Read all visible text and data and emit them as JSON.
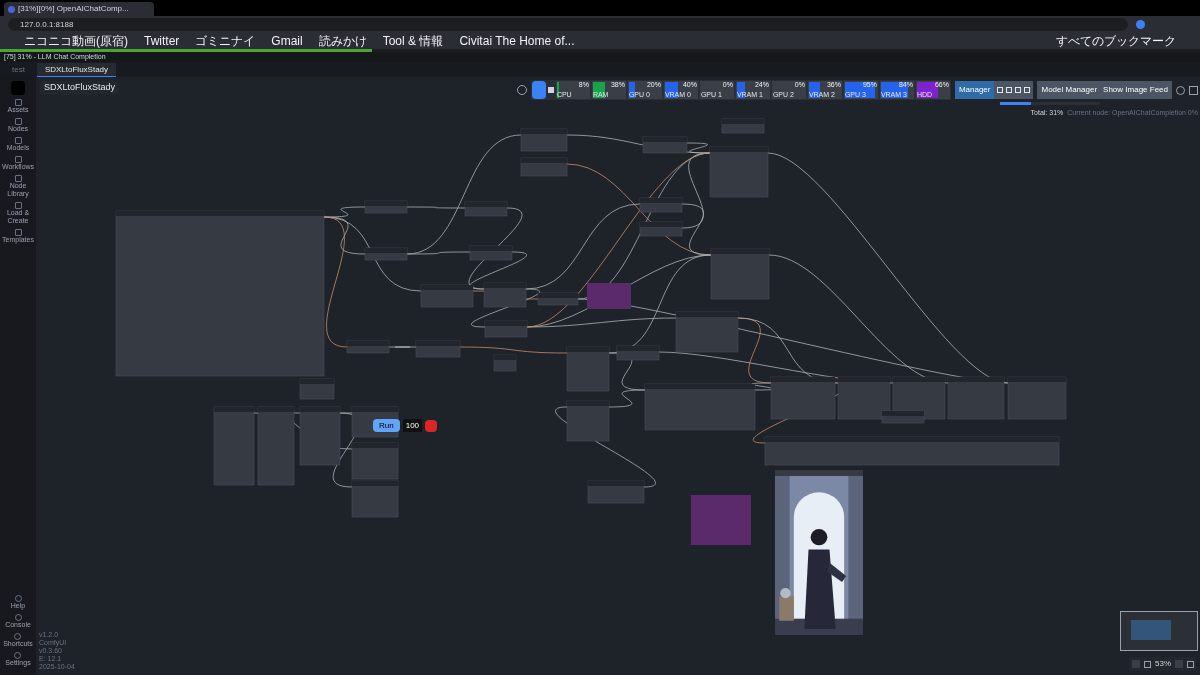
{
  "browser": {
    "tab_title": "[31%][0%] OpenAIChatComp...",
    "address": "127.0.0.1:8188",
    "bookmarks": [
      "ニコニコ動画(原宿)",
      "Twitter",
      "ゴミニナイ",
      "Gmail",
      "読みかけ",
      "Tool & 情報",
      "Civitai The Home of..."
    ],
    "all_bookmarks": "すべてのブックマーク"
  },
  "progress": {
    "text": "[75] 31% - LLM Chat Completion",
    "level": 0.31
  },
  "workflow_tabs": [
    {
      "label": "test",
      "selected": false
    },
    {
      "label": "SDXLtoFluxStady",
      "selected": true
    }
  ],
  "workflow_name": "SDXLtoFluxStady",
  "sidebar": {
    "items": [
      "Assets",
      "Nodes",
      "Models",
      "Workflows",
      "Node Library",
      "Load & Create",
      "Templates"
    ],
    "bottom_items": [
      "Help",
      "Console",
      "Shortcuts",
      "Settings"
    ],
    "version": [
      "v1.2.0",
      "ComfyUI",
      "v0.3.60",
      "E: 12.1",
      "2025-10-04"
    ]
  },
  "monitors": [
    {
      "kind": "cpu",
      "label": "CPU",
      "reading": "8%",
      "level": 0.08
    },
    {
      "kind": "ram",
      "label": "RAM",
      "reading": "38%",
      "level": 0.38
    },
    {
      "kind": "gpu",
      "label": "GPU 0",
      "reading": "20%",
      "level": 0.2
    },
    {
      "kind": "vram",
      "label": "VRAM 0",
      "reading": "40%",
      "level": 0.4
    },
    {
      "kind": "gpu",
      "label": "GPU 1",
      "reading": "0%",
      "level": 0
    },
    {
      "kind": "vram",
      "label": "VRAM 1",
      "reading": "24%",
      "level": 0.24
    },
    {
      "kind": "gpu",
      "label": "GPU 2",
      "reading": "0%",
      "level": 0
    },
    {
      "kind": "vram",
      "label": "VRAM 2",
      "reading": "36%",
      "level": 0.36
    },
    {
      "kind": "gpu",
      "label": "GPU 3",
      "reading": "95%",
      "level": 0.95
    },
    {
      "kind": "vram",
      "label": "VRAM 3",
      "reading": "84%",
      "level": 0.84
    },
    {
      "kind": "hdd",
      "label": "HDD",
      "reading": "66%",
      "level": 0.66
    }
  ],
  "toolbar": {
    "manager": "Manager",
    "model_manager": "Model Manager",
    "image_feed": "Show Image Feed"
  },
  "queue": {
    "total": "Total: 31%",
    "current": "Current node: OpenAIChatCompletion 0%",
    "level": 0.31
  },
  "run": {
    "label": "Run",
    "batch": "100"
  },
  "zoom": "53%"
}
